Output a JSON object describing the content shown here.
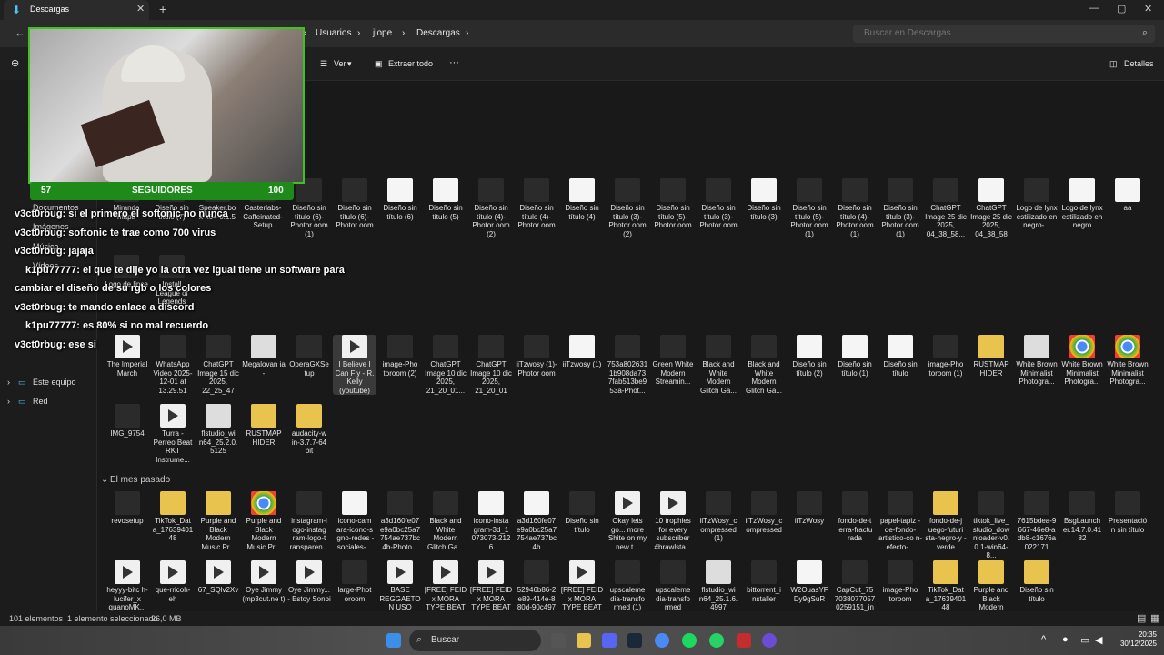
{
  "window": {
    "tab_title": "Descargas",
    "tab_close": "✕",
    "new_tab": "+",
    "minimize": "—",
    "maximize": "▢",
    "close": "✕"
  },
  "addressbar": {
    "crumbs": [
      "Usuarios",
      "jlope",
      "Descargas"
    ],
    "sep": "›",
    "search_placeholder": "Buscar en Descargas"
  },
  "toolbar": {
    "view": "Ver",
    "extract": "Extraer todo",
    "more": "···",
    "details": "Detalles"
  },
  "sidebar": {
    "items": [
      {
        "label": "Documentos"
      },
      {
        "label": "Imágenes"
      },
      {
        "label": "Música"
      },
      {
        "label": "Vídeos"
      },
      {
        "label": "Este equipo"
      },
      {
        "label": "Red"
      }
    ]
  },
  "overlay": {
    "followers_left": "57",
    "followers_label": "SEGUIDORES",
    "followers_right": "100",
    "chat": [
      {
        "user": "v3ct0rbug",
        "msg": ": si el primero el softonic no nunca"
      },
      {
        "user": "v3ct0rbug",
        "msg": ": softonic te trae como 700 virus"
      },
      {
        "user": "v3ct0rbug",
        "msg": ": jajaja"
      },
      {
        "user": "k1pu77777",
        "msg": ": el que te dije yo la otra vez igual tiene un software para"
      },
      {
        "user": "",
        "msg": "cambiar el diseño de su rgb o los colores"
      },
      {
        "user": "v3ct0rbug",
        "msg": ": te mando enlace a discord"
      },
      {
        "user": "k1pu77777",
        "msg": ": es 80% si no mal recuerdo"
      },
      {
        "user": "v3ct0rbug",
        "msg": ": ese si"
      }
    ]
  },
  "files_row1": [
    {
      "label": "Diseño sin título (6)-Photor oom (1)",
      "type": "img"
    },
    {
      "label": "Diseño sin título (6)-Photor oom",
      "type": "img"
    },
    {
      "label": "Diseño sin título (6)",
      "type": "white"
    },
    {
      "label": "Diseño sin título (5)",
      "type": "white"
    },
    {
      "label": "Diseño sin título (4)-Photor oom (2)",
      "type": "img"
    },
    {
      "label": "Diseño sin título (4)-Photor oom",
      "type": "img"
    },
    {
      "label": "Diseño sin título (4)",
      "type": "white"
    },
    {
      "label": "Diseño sin título (3)-Photor oom (2)",
      "type": "img"
    },
    {
      "label": "Diseño sin título (5)-Photor oom",
      "type": "img"
    },
    {
      "label": "Diseño sin título (3)-Photor oom",
      "type": "img"
    },
    {
      "label": "Diseño sin título (3)",
      "type": "white"
    },
    {
      "label": "Diseño sin título (5)-Photor oom (1)",
      "type": "img"
    },
    {
      "label": "Diseño sin título (4)-Photor oom (1)",
      "type": "img"
    },
    {
      "label": "Diseño sin título (3)-Photor oom (1)",
      "type": "img"
    },
    {
      "label": "ChatGPT Image 25 dic 2025, 04_38_58...",
      "type": "img"
    },
    {
      "label": "ChatGPT Image 25 dic 2025, 04_38_58",
      "type": "white"
    },
    {
      "label": "Logo de lynx estilizado en negro-...",
      "type": "img"
    },
    {
      "label": "Logo de lynx estilizado en negro",
      "type": "white"
    },
    {
      "label": "aa",
      "type": "white"
    }
  ],
  "files_row1_left": [
    {
      "label": "Miranda mapa"
    },
    {
      "label": "Diseño sin título (7)"
    },
    {
      "label": "Speaker.bo x-x64-0.1.5"
    },
    {
      "label": "Casterlabs-Caffeinated-Setup"
    }
  ],
  "files_row2_left": [
    {
      "label": "Logo de lince"
    },
    {
      "label": "Install League of Legends"
    }
  ],
  "files_row3": [
    {
      "label": "The Imperial March",
      "type": "vid"
    },
    {
      "label": "WhatsApp Video 2025-12-01 at 13.29.51",
      "type": "img"
    },
    {
      "label": "ChatGPT Image 15 dic 2025, 22_25_47",
      "type": "img"
    },
    {
      "label": "Megalovan ia -",
      "type": "doc"
    },
    {
      "label": "OperaGXSe tup",
      "type": "img"
    },
    {
      "label": "I Believe I Can Fly - R. Kelly (youtube)",
      "type": "vid",
      "selected": true
    },
    {
      "label": "image-Pho toroom (2)",
      "type": "img"
    },
    {
      "label": "ChatGPT Image 10 dic 2025, 21_20_01...",
      "type": "img"
    },
    {
      "label": "ChatGPT Image 10 dic 2025, 21_20_01",
      "type": "img"
    },
    {
      "label": "iiTzwosy (1)-Photor oom",
      "type": "img"
    },
    {
      "label": "iiTzwosy (1)",
      "type": "white"
    },
    {
      "label": "753a802631 1b908da73 7fab513be9 53a-Phot...",
      "type": "img"
    },
    {
      "label": "Green White Modern Streamin...",
      "type": "img"
    },
    {
      "label": "Black and White Modern Glitch Ga...",
      "type": "img"
    },
    {
      "label": "Black and White Modern Glitch Ga...",
      "type": "img"
    },
    {
      "label": "Diseño sin título (2)",
      "type": "white"
    },
    {
      "label": "Diseño sin título (1)",
      "type": "white"
    },
    {
      "label": "Diseño sin título",
      "type": "white"
    },
    {
      "label": "image-Pho toroom (1)",
      "type": "img"
    },
    {
      "label": "RUSTMAP HIDER",
      "type": "folder"
    },
    {
      "label": "White Brown Minimalist Photogra...",
      "type": "doc"
    },
    {
      "label": "White Brown Minimalist Photogra...",
      "type": "chrome"
    },
    {
      "label": "White Brown Minimalist Photogra...",
      "type": "chrome"
    }
  ],
  "files_row4": [
    {
      "label": "IMG_9754",
      "type": "img"
    },
    {
      "label": "Turra - Perreo Beat RKT Instrume...",
      "type": "vid"
    },
    {
      "label": "flstudio_wi n64_25.2.0. 5125",
      "type": "doc"
    },
    {
      "label": "RUSTMAP HIDER",
      "type": "folder"
    },
    {
      "label": "audacity-w in-3.7.7-64 bit",
      "type": "folder"
    }
  ],
  "section_label": "El mes pasado",
  "files_row5": [
    {
      "label": "revosetup",
      "type": "img"
    },
    {
      "label": "TikTok_Dat a_17639401 48",
      "type": "folder"
    },
    {
      "label": "Purple and Black Modern Music Pr...",
      "type": "folder"
    },
    {
      "label": "Purple and Black Modern Music Pr...",
      "type": "chrome"
    },
    {
      "label": "instagram-l ogo-instag ram-logo-t ransparen...",
      "type": "img"
    },
    {
      "label": "icono-cam ara-icono-s igno-redes -sociales-...",
      "type": "white"
    },
    {
      "label": "a3d160fe07 e9a0bc25a7 754ae737bc 4b-Photo...",
      "type": "img"
    },
    {
      "label": "Black and White Modern Glitch Ga...",
      "type": "img"
    },
    {
      "label": "icono-insta gram-3d_1 073073-212 6",
      "type": "white"
    },
    {
      "label": "a3d160fe07 e9a0bc25a7 754ae737bc 4b",
      "type": "white"
    },
    {
      "label": "Diseño sin título",
      "type": "img"
    },
    {
      "label": "Okay lets go... more Shite on my new t...",
      "type": "vid"
    },
    {
      "label": "10 trophies for every subscriber #brawlsta...",
      "type": "vid"
    },
    {
      "label": "iiTzWosy_c ompressed (1)",
      "type": "img"
    },
    {
      "label": "iiTzWosy_c ompressed",
      "type": "img"
    },
    {
      "label": "iiTzWosy",
      "type": "img"
    },
    {
      "label": "fondo-de-t ierra-fractu rada",
      "type": "img"
    },
    {
      "label": "papel-tapiz -de-fondo- artistico-co n-efecto-...",
      "type": "img"
    },
    {
      "label": "fondo-de-j uego-futuri sta-negro-y -verde",
      "type": "folder"
    },
    {
      "label": "tiktok_live_ studio_dow nloader-v0. 0.1-win64-8...",
      "type": "img"
    },
    {
      "label": "7615bdea-9 667-46e8-a db8-c1676a 022171",
      "type": "img"
    },
    {
      "label": "BsgLaunch er.14.7.0.41 82",
      "type": "img"
    },
    {
      "label": "Presentació n sin título",
      "type": "img"
    }
  ],
  "files_row6": [
    {
      "label": "heyyy-bitc h-lucifer_x quanoMK...",
      "type": "vid"
    },
    {
      "label": "que-rricoh- eh",
      "type": "vid"
    },
    {
      "label": "67_SQlv2Xv",
      "type": "vid"
    },
    {
      "label": "Oye Jimmy (mp3cut.ne t)",
      "type": "vid"
    },
    {
      "label": "Oye Jimmy... - Estoy Sonbi",
      "type": "vid"
    },
    {
      "label": "large-Phot oroom",
      "type": "img"
    },
    {
      "label": "BASE REGGAETO N USO",
      "type": "vid"
    },
    {
      "label": "[FREE] FEID x MORA TYPE BEAT",
      "type": "vid"
    },
    {
      "label": "[FREE] FEID x MORA TYPE BEAT",
      "type": "vid"
    },
    {
      "label": "52946b86-2 e89-414e-8 80d-90c497",
      "type": "img"
    },
    {
      "label": "[FREE] FEID x MORA TYPE BEAT",
      "type": "vid"
    },
    {
      "label": "upscaleme dia-transfo rmed (1)",
      "type": "img"
    },
    {
      "label": "upscaleme dia-transfo rmed",
      "type": "img"
    },
    {
      "label": "flstudio_wi n64_25.1.6. 4997",
      "type": "doc"
    },
    {
      "label": "bittorrent_i nstaller",
      "type": "img"
    },
    {
      "label": "W2OuasYF Dy9gSuR",
      "type": "white"
    },
    {
      "label": "CapCut_75 7038077057 0259151_in",
      "type": "img"
    },
    {
      "label": "image-Pho toroom",
      "type": "img"
    },
    {
      "label": "TikTok_Dat a_17639401 48",
      "type": "folder"
    },
    {
      "label": "Purple and Black Modern",
      "type": "folder"
    },
    {
      "label": "Diseño sin título",
      "type": "folder"
    }
  ],
  "status": {
    "count": "101 elementos",
    "selected": "1 elemento seleccionado",
    "size": "26,0 MB"
  },
  "taskbar": {
    "search": "Buscar",
    "time": "20:35",
    "date": "30/12/2025"
  },
  "colors": {
    "accent_green": "#3ec21f",
    "folder": "#e8c44f",
    "bg": "#191919"
  }
}
